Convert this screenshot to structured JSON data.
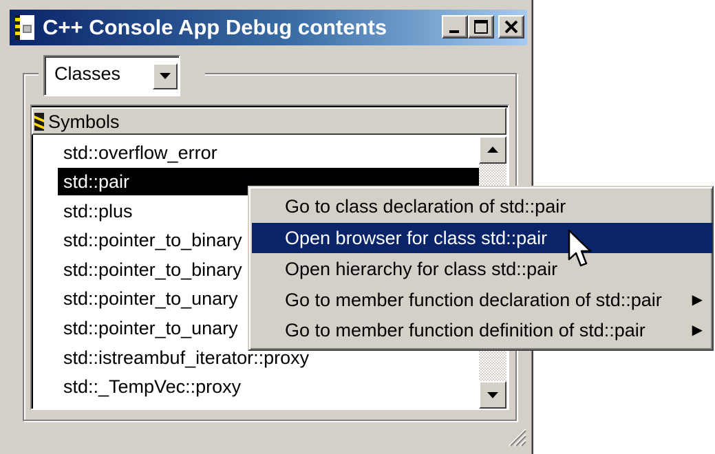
{
  "window": {
    "title": "C++ Console App Debug contents"
  },
  "filter": {
    "selected": "Classes"
  },
  "list": {
    "header": "Symbols",
    "items": [
      "std::overflow_error",
      "std::pair",
      "std::plus",
      "std::pointer_to_binary",
      "std::pointer_to_binary",
      "std::pointer_to_unary",
      "std::pointer_to_unary",
      "std::istreambuf_iterator::proxy",
      "std::_TempVec::proxy"
    ],
    "selected_index": 1
  },
  "context_menu": {
    "items": [
      {
        "label": "Go to class declaration of std::pair",
        "submenu": false,
        "highlighted": false
      },
      {
        "label": "Open browser for class std::pair",
        "submenu": false,
        "highlighted": true
      },
      {
        "label": "Open hierarchy for class std::pair",
        "submenu": false,
        "highlighted": false
      },
      {
        "label": "Go to member function declaration of std::pair",
        "submenu": true,
        "highlighted": false
      },
      {
        "label": "Go to member function definition of std::pair",
        "submenu": true,
        "highlighted": false
      }
    ]
  },
  "icons": {
    "app": "document-app-icon",
    "header": "symbols-icon",
    "minimize": "minimize-icon",
    "maximize": "maximize-icon",
    "close": "close-icon",
    "dropdown": "chevron-down-icon",
    "scroll_up": "scroll-up-icon",
    "scroll_down": "scroll-down-icon",
    "submenu": "submenu-arrow-icon",
    "cursor": "mouse-pointer-icon",
    "grip": "resize-grip-icon"
  },
  "colors": {
    "title_start": "#0a246a",
    "title_end": "#a6caf0",
    "face": "#d4d0c8",
    "highlight": "#0a246a"
  }
}
